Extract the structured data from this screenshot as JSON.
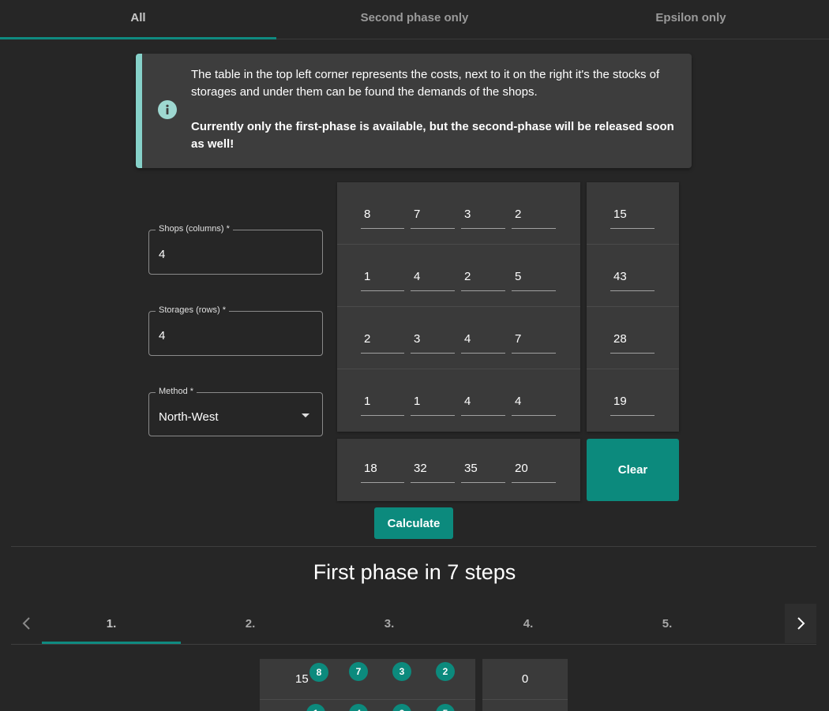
{
  "top_tabs": [
    {
      "label": "All",
      "active": true
    },
    {
      "label": "Second phase only",
      "active": false
    },
    {
      "label": "Epsilon only",
      "active": false
    }
  ],
  "alert": {
    "icon": "info-icon",
    "accent_color": "#86d1c9",
    "paragraph1": "The table in the top left corner represents the costs, next to it on the right it's the stocks of storages and under them can be found the demands of the shops.",
    "paragraph2": "Currently only the first-phase is available, but the second-phase will be released soon as well!"
  },
  "form": {
    "shops": {
      "label": "Shops (columns) *",
      "value": "4"
    },
    "storages": {
      "label": "Storages (rows) *",
      "value": "4"
    },
    "method": {
      "label": "Method *",
      "value": "North-West"
    }
  },
  "costs": [
    [
      "8",
      "7",
      "3",
      "2"
    ],
    [
      "1",
      "4",
      "2",
      "5"
    ],
    [
      "2",
      "3",
      "4",
      "7"
    ],
    [
      "1",
      "1",
      "4",
      "4"
    ]
  ],
  "stocks": [
    "15",
    "43",
    "28",
    "19"
  ],
  "demands": [
    "18",
    "32",
    "35",
    "20"
  ],
  "buttons": {
    "clear": "Clear",
    "calculate": "Calculate",
    "accent_color": "#0c8a7d"
  },
  "phase_title": "First phase in 7 steps",
  "step_tabs": [
    {
      "label": "1.",
      "active": true
    },
    {
      "label": "2.",
      "active": false
    },
    {
      "label": "3.",
      "active": false
    },
    {
      "label": "4.",
      "active": false
    },
    {
      "label": "5.",
      "active": false
    }
  ],
  "step_result": {
    "row1": {
      "allocation": "15",
      "costs": [
        "8",
        "7",
        "3",
        "2"
      ],
      "remaining_stock": "0"
    },
    "row2": {
      "costs": [
        "1",
        "4",
        "2",
        "5"
      ]
    }
  }
}
